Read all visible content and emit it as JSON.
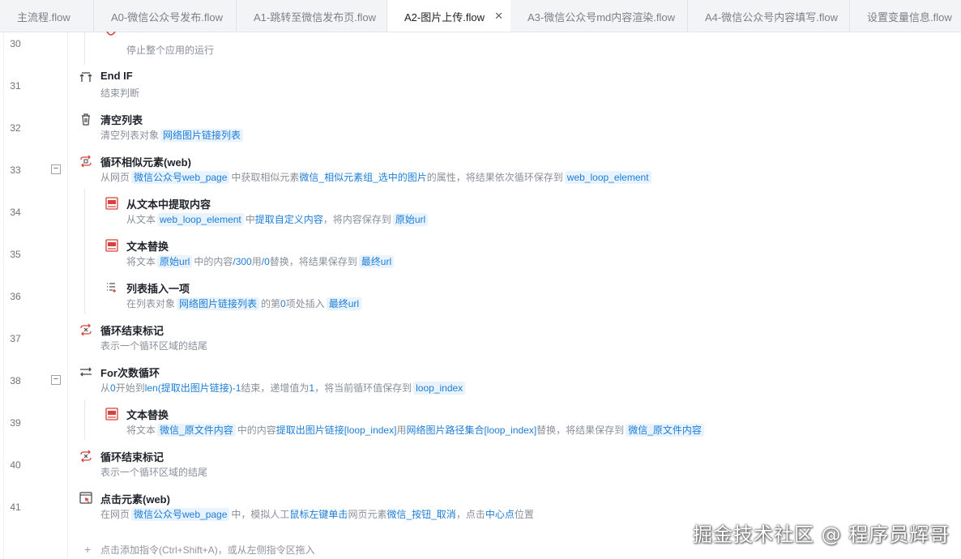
{
  "tabs": [
    {
      "label": "主流程.flow",
      "active": false
    },
    {
      "label": "A0-微信公众号发布.flow",
      "active": false
    },
    {
      "label": "A1-跳转至微信发布页.flow",
      "active": false
    },
    {
      "label": "A2-图片上传.flow",
      "active": true
    },
    {
      "label": "A3-微信公众号md内容渲染.flow",
      "active": false
    },
    {
      "label": "A4-微信公众号内容填写.flow",
      "active": false
    },
    {
      "label": "设置变量信息.flow",
      "active": false
    }
  ],
  "tab_close_glyph": "✕",
  "fold_glyph": "−",
  "rows": [
    {
      "line": "30",
      "title": "",
      "desc": [
        {
          "t": "停止整个应用的运行"
        }
      ],
      "icon": "stop-icon"
    },
    {
      "line": "31",
      "title": "End IF",
      "desc": [
        {
          "t": "结束判断"
        }
      ],
      "icon": "end-if-icon"
    },
    {
      "line": "32",
      "title": "清空列表",
      "desc": [
        {
          "t": "清空列表对象"
        },
        {
          "c": "网络图片链接列表"
        }
      ],
      "icon": "trash-icon"
    },
    {
      "line": "33",
      "title": "循环相似元素(web)",
      "fold": true,
      "icon": "loop-web-icon",
      "desc": [
        {
          "t": "从网页"
        },
        {
          "c": "微信公众号web_page"
        },
        {
          "t": "中获取相似元素"
        },
        {
          "k": "微信_相似元素组_选中的图片"
        },
        {
          "t": "的属性，将结果依次循环保存到"
        },
        {
          "c": "web_loop_element"
        }
      ]
    },
    {
      "line": "34",
      "title": "从文本中提取内容",
      "icon": "text-extract-icon",
      "desc": [
        {
          "t": "从文本"
        },
        {
          "c": "web_loop_element"
        },
        {
          "t": "中"
        },
        {
          "k": "提取自定义内容"
        },
        {
          "t": "，将内容保存到"
        },
        {
          "c": "原始url"
        }
      ]
    },
    {
      "line": "35",
      "title": "文本替换",
      "icon": "text-replace-icon",
      "desc": [
        {
          "t": "将文本"
        },
        {
          "c": "原始url"
        },
        {
          "t": "中的内容"
        },
        {
          "k": "/300"
        },
        {
          "t": "用"
        },
        {
          "k": "/0"
        },
        {
          "t": "替换，将结果保存到"
        },
        {
          "c": "最终url"
        }
      ]
    },
    {
      "line": "36",
      "title": "列表插入一项",
      "icon": "list-insert-icon",
      "desc": [
        {
          "t": "在列表对象"
        },
        {
          "c": "网络图片链接列表"
        },
        {
          "t": "的第"
        },
        {
          "k": "0"
        },
        {
          "t": "项处插入"
        },
        {
          "c": "最终url"
        }
      ]
    },
    {
      "line": "37",
      "title": "循环结束标记",
      "desc": [
        {
          "t": "表示一个循环区域的结尾"
        }
      ],
      "icon": "loop-end-icon"
    },
    {
      "line": "38",
      "title": "For次数循环",
      "fold": true,
      "icon": "for-loop-icon",
      "desc": [
        {
          "t": "从"
        },
        {
          "k": "0"
        },
        {
          "t": "开始到"
        },
        {
          "k": "len(提取出图片链接)-1"
        },
        {
          "t": "结束，递增值为"
        },
        {
          "k": "1"
        },
        {
          "t": "，将当前循环值保存到"
        },
        {
          "c": "loop_index"
        }
      ]
    },
    {
      "line": "39",
      "title": "文本替换",
      "icon": "text-replace-icon",
      "desc": [
        {
          "t": "将文本"
        },
        {
          "c": "微信_原文件内容"
        },
        {
          "t": "中的内容"
        },
        {
          "k": "提取出图片链接[loop_index]"
        },
        {
          "t": "用"
        },
        {
          "k": "网络图片路径集合[loop_index]"
        },
        {
          "t": "替换，将结果保存到"
        },
        {
          "c": "微信_原文件内容"
        }
      ]
    },
    {
      "line": "40",
      "title": "循环结束标记",
      "desc": [
        {
          "t": "表示一个循环区域的结尾"
        }
      ],
      "icon": "loop-end-icon"
    },
    {
      "line": "41",
      "title": "点击元素(web)",
      "icon": "click-web-icon",
      "desc": [
        {
          "t": "在网页"
        },
        {
          "c": "微信公众号web_page"
        },
        {
          "t": "中，模拟人工"
        },
        {
          "k": "鼠标左键单击"
        },
        {
          "t": "网页元素"
        },
        {
          "k": "微信_按钮_取消"
        },
        {
          "t": "，点击"
        },
        {
          "k": "中心点"
        },
        {
          "t": "位置"
        }
      ]
    }
  ],
  "add_hint": "点击添加指令(Ctrl+Shift+A)，或从左侧指令区拖入",
  "add_glyph": "+",
  "watermark": "掘金技术社区 @ 程序员辉哥",
  "colors": {
    "accent": "#1d7dd6",
    "chip_bg": "#e8f3fd",
    "icon_red": "#d9413a"
  }
}
